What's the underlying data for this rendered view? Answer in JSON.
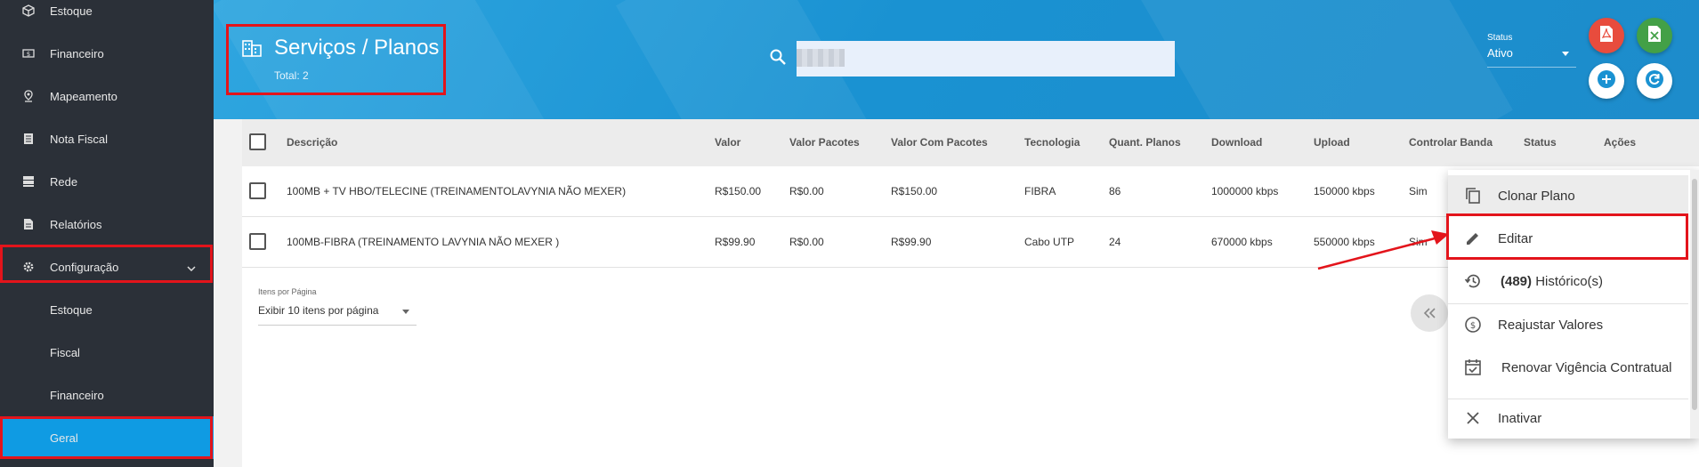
{
  "sidebar": {
    "items": [
      {
        "label": "Estoque",
        "icon": "box-icon"
      },
      {
        "label": "Financeiro",
        "icon": "money-icon"
      },
      {
        "label": "Mapeamento",
        "icon": "pin-icon"
      },
      {
        "label": "Nota Fiscal",
        "icon": "receipt-icon"
      },
      {
        "label": "Rede",
        "icon": "server-icon"
      },
      {
        "label": "Relatórios",
        "icon": "report-icon"
      },
      {
        "label": "Configuração",
        "icon": "gear-icon"
      }
    ],
    "subitems": [
      {
        "label": "Estoque"
      },
      {
        "label": "Fiscal"
      },
      {
        "label": "Financeiro"
      },
      {
        "label": "Geral"
      }
    ]
  },
  "header": {
    "title": "Serviços / Planos",
    "total": "Total: 2",
    "status_label": "Status",
    "status_value": "Ativo"
  },
  "table": {
    "columns": [
      "Descrição",
      "Valor",
      "Valor Pacotes",
      "Valor Com Pacotes",
      "Tecnologia",
      "Quant. Planos",
      "Download",
      "Upload",
      "Controlar Banda",
      "Status",
      "Ações"
    ],
    "rows": [
      {
        "descricao": "100MB + TV HBO/TELECINE (TREINAMENTOLAVYNIA NÃO MEXER)",
        "valor": "R$150.00",
        "valor_pacotes": "R$0.00",
        "valor_com_pacotes": "R$150.00",
        "tecnologia": "FIBRA",
        "quant_planos": "86",
        "download": "1000000 kbps",
        "upload": "150000 kbps",
        "controlar_banda": "Sim"
      },
      {
        "descricao": "100MB-FIBRA (TREINAMENTO LAVYNIA NÃO MEXER )",
        "valor": "R$99.90",
        "valor_pacotes": "R$0.00",
        "valor_com_pacotes": "R$99.90",
        "tecnologia": "Cabo UTP",
        "quant_planos": "24",
        "download": "670000 kbps",
        "upload": "550000 kbps",
        "controlar_banda": "Sim"
      }
    ]
  },
  "pagination": {
    "label": "Itens por Página",
    "value": "Exibir 10 itens por página"
  },
  "menu": {
    "items": [
      {
        "label": "Clonar Plano",
        "icon": "copy-icon"
      },
      {
        "label": "Editar",
        "icon": "pencil-icon"
      },
      {
        "count": "(489)",
        "label": "Histórico(s)",
        "icon": "history-icon"
      },
      {
        "label": "Reajustar Valores",
        "icon": "dollar-circle-icon"
      },
      {
        "label": "Renovar Vigência Contratual",
        "icon": "calendar-check-icon"
      },
      {
        "label": "Inativar",
        "icon": "close-icon"
      }
    ]
  },
  "colors": {
    "sidebar_bg": "#2b3038",
    "active": "#0f9be3",
    "header": "#1a92d2",
    "highlight": "#e3141b",
    "pdf_btn": "#e84c3d",
    "excel_btn": "#43a047"
  }
}
